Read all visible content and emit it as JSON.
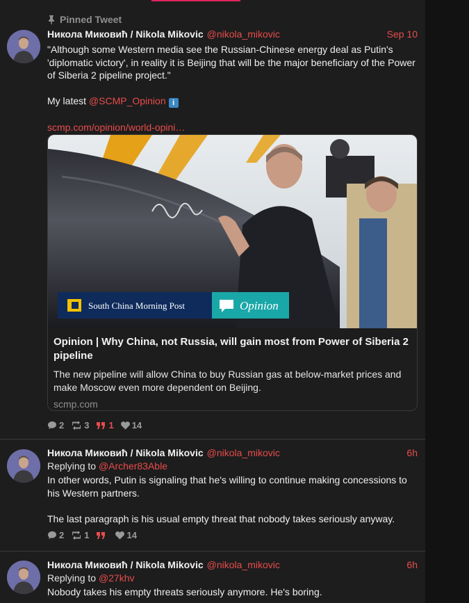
{
  "pinned_label": "Pinned Tweet",
  "tweets": [
    {
      "author_name": "Никола Миковић / Nikola Mikovic",
      "handle": "@nikola_mikovic",
      "time": "Sep 10",
      "text_line1": "\"Although some Western media see the Russian-Chinese energy deal as Putin's 'diplomatic victory', in reality it is Beijing that will be the major beneficiary of the Power of Siberia 2 pipeline project.\"",
      "text_prefix": "My latest",
      "mention": "@SCMP_Opinion",
      "info_emoji": "ℹ️",
      "link": "scmp.com/opinion/world-opini…",
      "card": {
        "brand": "South China Morning Post",
        "badge": "Opinion",
        "title": "Opinion | Why China, not Russia, will gain most from Power of Siberia 2 pipeline",
        "description": "The new pipeline will allow China to buy Russian gas at below-market prices and make Moscow even more dependent on Beijing.",
        "domain": "scmp.com"
      },
      "replies": "2",
      "retweets": "3",
      "quotes": "1",
      "likes": "14"
    },
    {
      "author_name": "Никола Миковић / Nikola Mikovic",
      "handle": "@nikola_mikovic",
      "time": "6h",
      "replying_label": "Replying to",
      "replying_to": "@Archer83Able",
      "text_line1": "In other words, Putin is signaling that he's willing to continue making concessions to his Western partners.",
      "text_line2": "The last paragraph is his usual empty threat that nobody takes seriously anyway.",
      "replies": "2",
      "retweets": "1",
      "quotes": "",
      "likes": "14"
    },
    {
      "author_name": "Никола Миковић / Nikola Mikovic",
      "handle": "@nikola_mikovic",
      "time": "6h",
      "replying_label": "Replying to",
      "replying_to": "@27khv",
      "text_line1": "Nobody takes his empty threats seriously anymore. He's boring."
    }
  ],
  "colors": {
    "background": "#1d1d1d",
    "accent": "#e94c4c",
    "muted": "#8f8f8f",
    "border": "#3a3a3a"
  },
  "icons": [
    "pin-icon",
    "reply-icon",
    "retweet-icon",
    "quote-icon",
    "heart-icon",
    "info-icon"
  ]
}
